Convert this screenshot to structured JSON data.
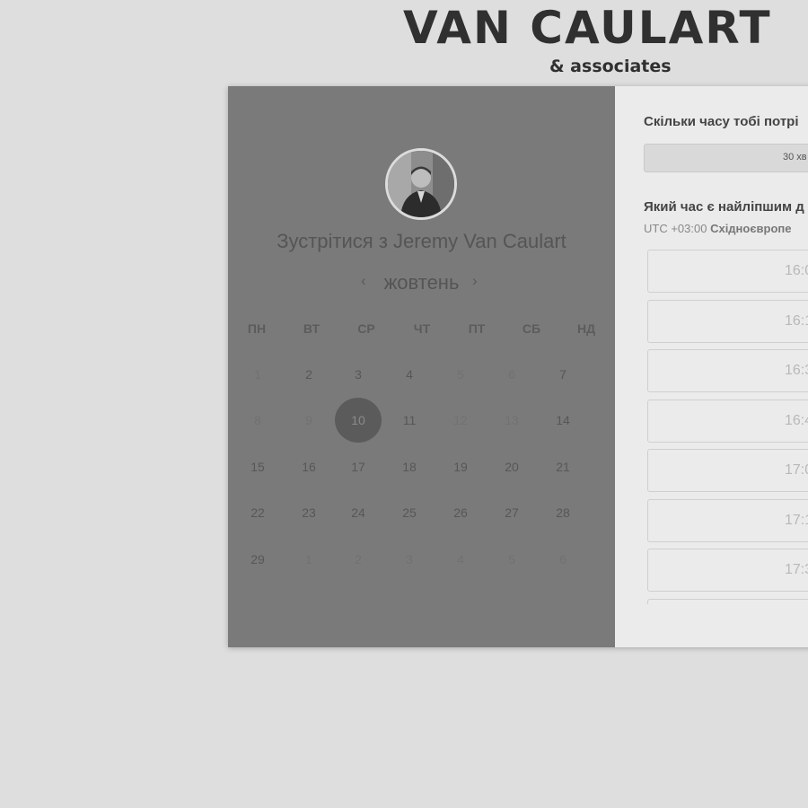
{
  "brand": {
    "name": "VAN CAULART",
    "tagline": "& associates"
  },
  "booking": {
    "title": "Зустрітися з Jeremy Van Caulart",
    "month": "жовтень",
    "weekdays": [
      "ПН",
      "ВТ",
      "СР",
      "ЧТ",
      "ПТ",
      "СБ",
      "НД"
    ],
    "days": [
      {
        "label": "1",
        "state": "muted"
      },
      {
        "label": "2",
        "state": "available"
      },
      {
        "label": "3",
        "state": "available"
      },
      {
        "label": "4",
        "state": "available"
      },
      {
        "label": "5",
        "state": "muted"
      },
      {
        "label": "6",
        "state": "muted"
      },
      {
        "label": "7",
        "state": "available"
      },
      {
        "label": "8",
        "state": "muted"
      },
      {
        "label": "9",
        "state": "muted"
      },
      {
        "label": "10",
        "state": "selected"
      },
      {
        "label": "11",
        "state": "available"
      },
      {
        "label": "12",
        "state": "muted"
      },
      {
        "label": "13",
        "state": "muted"
      },
      {
        "label": "14",
        "state": "available"
      },
      {
        "label": "15",
        "state": "available"
      },
      {
        "label": "16",
        "state": "available"
      },
      {
        "label": "17",
        "state": "available"
      },
      {
        "label": "18",
        "state": "available"
      },
      {
        "label": "19",
        "state": "available"
      },
      {
        "label": "20",
        "state": "available"
      },
      {
        "label": "21",
        "state": "available"
      },
      {
        "label": "22",
        "state": "available"
      },
      {
        "label": "23",
        "state": "available"
      },
      {
        "label": "24",
        "state": "available"
      },
      {
        "label": "25",
        "state": "available"
      },
      {
        "label": "26",
        "state": "available"
      },
      {
        "label": "27",
        "state": "available"
      },
      {
        "label": "28",
        "state": "available"
      },
      {
        "label": "29",
        "state": "available"
      },
      {
        "label": "1",
        "state": "muted"
      },
      {
        "label": "2",
        "state": "muted"
      },
      {
        "label": "3",
        "state": "muted"
      },
      {
        "label": "4",
        "state": "muted"
      },
      {
        "label": "5",
        "state": "muted"
      },
      {
        "label": "6",
        "state": "muted"
      }
    ]
  },
  "scheduler": {
    "duration_question": "Скільки часу тобі потрі",
    "duration_option": "30 хв",
    "time_question": "Який час є найліпшим д",
    "tz_offset": "UTC +03:00",
    "tz_name": "Східноєвропе",
    "slots": [
      "16:0",
      "16:1",
      "16:3",
      "16:4",
      "17:0",
      "17:1",
      "17:3",
      ""
    ]
  },
  "icons": {
    "prev": "chevron-left-icon",
    "next": "chevron-right-icon"
  },
  "colors": {
    "panel_left": "#7a7a7a",
    "panel_right": "#ebebeb",
    "selected_day": "#5b5b5b",
    "background": "#dedede"
  }
}
